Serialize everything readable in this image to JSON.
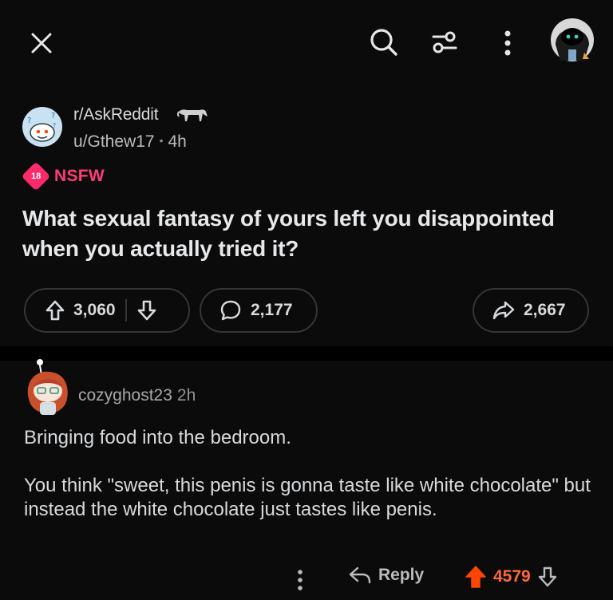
{
  "topbar": {
    "close_icon": "close-icon",
    "search_icon": "search-icon",
    "filter_icon": "filter-icon",
    "more_icon": "more-vertical-icon",
    "avatar_icon": "user-avatar-icon"
  },
  "post": {
    "subreddit": "r/AskReddit",
    "author": "u/Gthew17",
    "separator": "•",
    "age": "4h",
    "nsfw_badge": "18",
    "nsfw_label": "NSFW",
    "title": "What sexual fantasy of yours left you disappointed when you actually tried it?",
    "upvotes": "3,060",
    "comments": "2,177",
    "shares": "2,667"
  },
  "comment": {
    "username": "cozyghost23",
    "age": "2h",
    "paragraphs": [
      "Bringing food into the bedroom.",
      "You think \"sweet, this penis is gonna taste like white chocolate\" but instead the white chocolate just tastes like penis."
    ],
    "reply_label": "Reply",
    "score": "4579"
  },
  "colors": {
    "background": "#0b0b0c",
    "nsfw": "#ff3d75",
    "upvoted": "#ff6a3d",
    "border": "#343536"
  }
}
